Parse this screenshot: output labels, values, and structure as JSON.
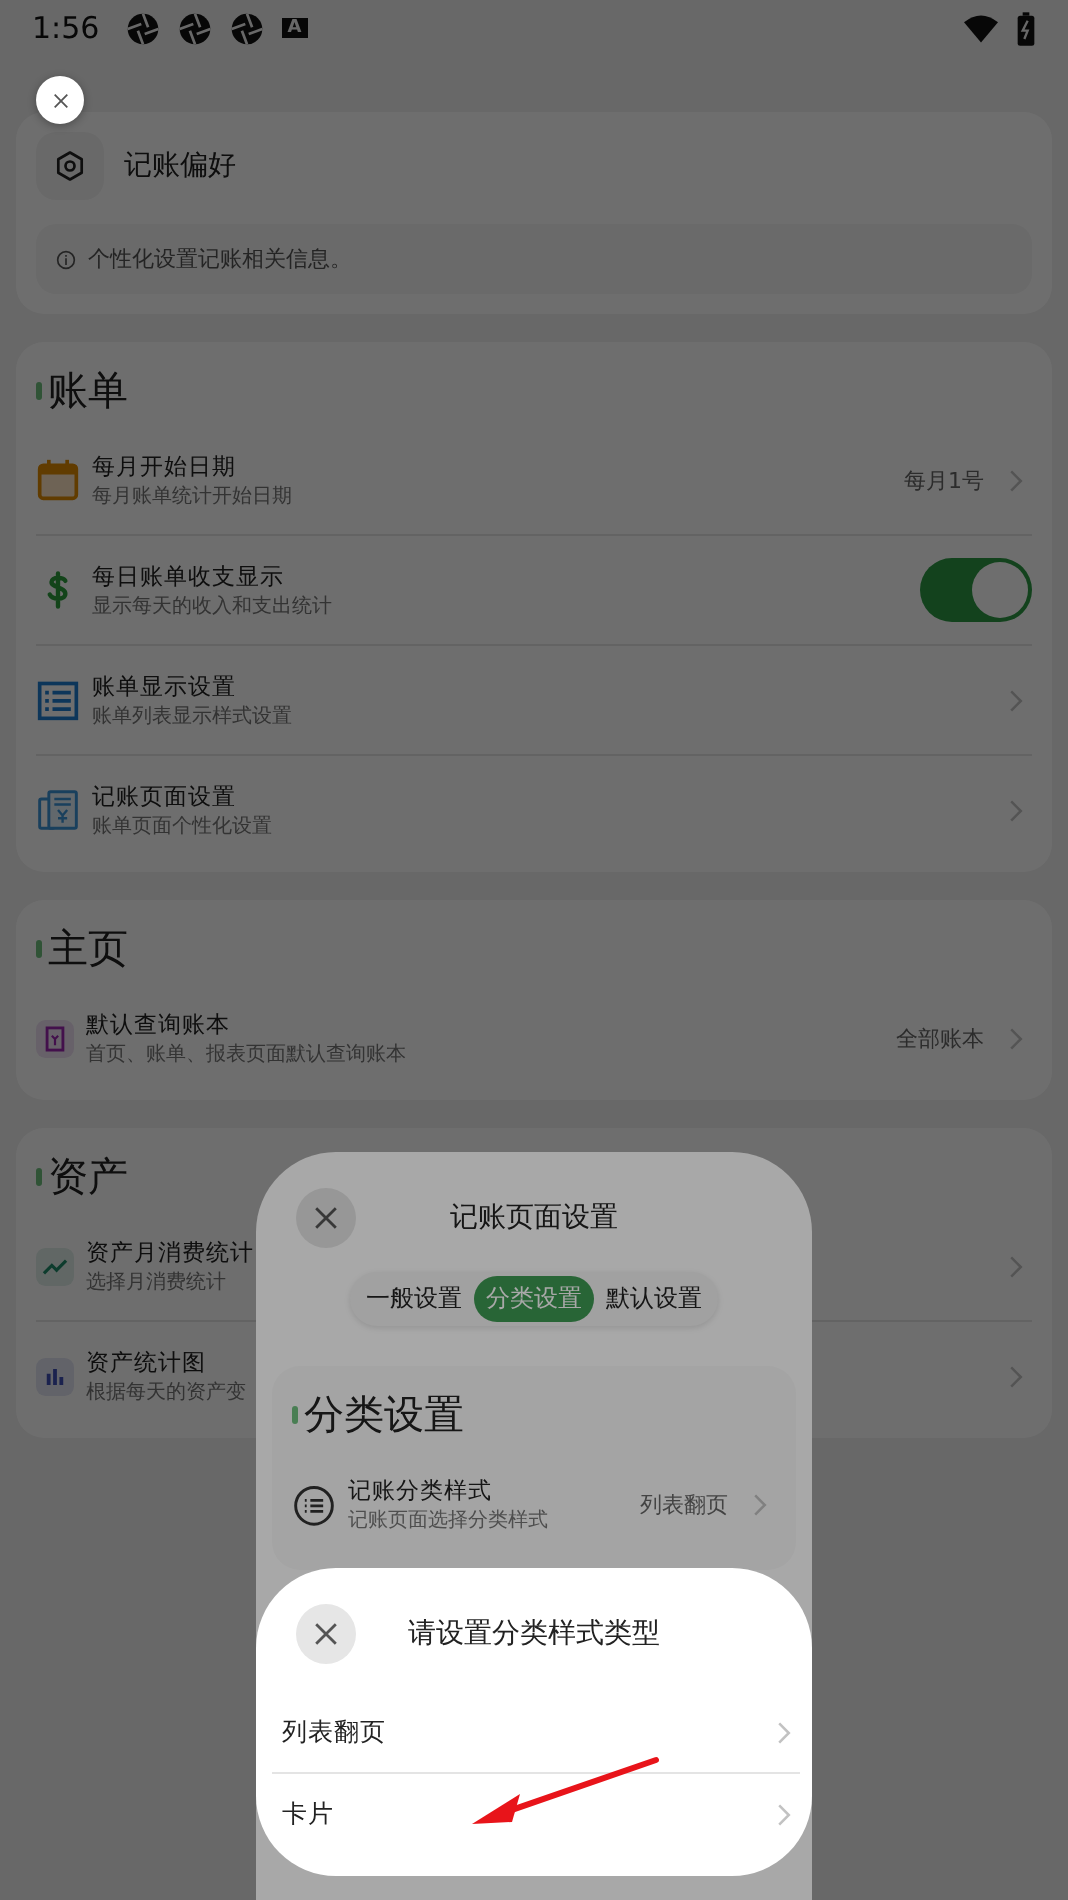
{
  "status_bar": {
    "time": "1:56",
    "notification_badge": "A"
  },
  "preferences_card": {
    "title": "记账偏好",
    "info": "个性化设置记账相关信息。"
  },
  "sections": [
    {
      "title": "账单",
      "items": [
        {
          "kind": "link",
          "title": "每月开始日期",
          "subtitle": "每月账单统计开始日期",
          "value": "每月1号"
        },
        {
          "kind": "toggle",
          "title": "每日账单收支显示",
          "subtitle": "显示每天的收入和支出统计",
          "on": true
        },
        {
          "kind": "link",
          "title": "账单显示设置",
          "subtitle": "账单列表显示样式设置"
        },
        {
          "kind": "link",
          "title": "记账页面设置",
          "subtitle": "账单页面个性化设置"
        }
      ]
    },
    {
      "title": "主页",
      "items": [
        {
          "kind": "link",
          "title": "默认查询账本",
          "subtitle": "首页、账单、报表页面默认查询账本",
          "value": "全部账本"
        }
      ]
    },
    {
      "title": "资产",
      "items": [
        {
          "kind": "link",
          "title": "资产月消费统计",
          "subtitle": "选择月消费统计"
        },
        {
          "kind": "link",
          "title": "资产统计图",
          "subtitle": "根据每天的资产变"
        }
      ]
    }
  ],
  "page_settings_sheet": {
    "title": "记账页面设置",
    "tabs": [
      {
        "label": "一般设置",
        "selected": false
      },
      {
        "label": "分类设置",
        "selected": true
      },
      {
        "label": "默认设置",
        "selected": false
      }
    ],
    "section_title": "分类设置",
    "item": {
      "title": "记账分类样式",
      "subtitle": "记账页面选择分类样式",
      "value": "列表翻页"
    }
  },
  "style_type_sheet": {
    "title": "请设置分类样式类型",
    "options": [
      {
        "label": "列表翻页"
      },
      {
        "label": "卡片"
      }
    ]
  }
}
